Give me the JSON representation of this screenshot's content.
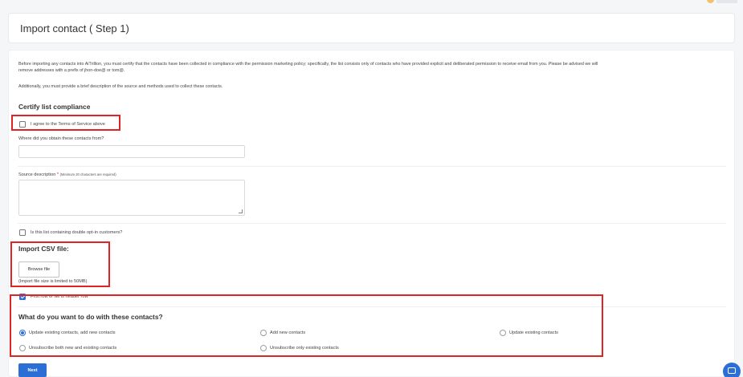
{
  "page": {
    "title": "Import contact ( Step 1)"
  },
  "intro": {
    "paragraph_line1": "Before importing any contacts into AiTrillion, you must certify that the contacts have been collected in compliance with the permission marketing policy; specifically, the list consists only of contacts who have provided explicit and deliberated permission to receive email from you. Please be advised we will",
    "paragraph_line2": "remove addresses with a prefix of jhon-doe@ or tom@.",
    "paragraph2": "Additionally, you must provide a brief description of the source and methods used to collect these contacts."
  },
  "compliance": {
    "heading": "Certify list compliance",
    "agree_label": "I agree to the Terms of Service above",
    "agree_checked": false,
    "source_label": "Where did you obtain these contacts from?",
    "source_value": "",
    "description_label": "Source description",
    "description_required_mark": "*",
    "description_hint": "(Minimum 20 characters are required)",
    "description_value": "",
    "double_optin_label": "Is this list containing double opt-in customers?",
    "double_optin_checked": false
  },
  "csv": {
    "heading": "Import CSV file:",
    "browse_label": "Browse file",
    "note": "(Import file size is limited to 50MB)",
    "header_row_label": "First row of file is header row",
    "header_row_checked": true
  },
  "action": {
    "heading": "What do you want to do with these contacts?",
    "options": [
      {
        "label": "Update existing contacts, add new contacts",
        "selected": true
      },
      {
        "label": "Add new contacts",
        "selected": false
      },
      {
        "label": "Update existing contacts",
        "selected": false
      },
      {
        "label": "Unsubscribe both new and existing contacts",
        "selected": false
      },
      {
        "label": "Unsubscribe only existing contacts",
        "selected": false
      }
    ]
  },
  "footer": {
    "next_label": "Next"
  },
  "colors": {
    "accent": "#2b6fd6",
    "highlight": "#e02424"
  },
  "icons": {
    "chat": "chat-bubble-icon"
  }
}
